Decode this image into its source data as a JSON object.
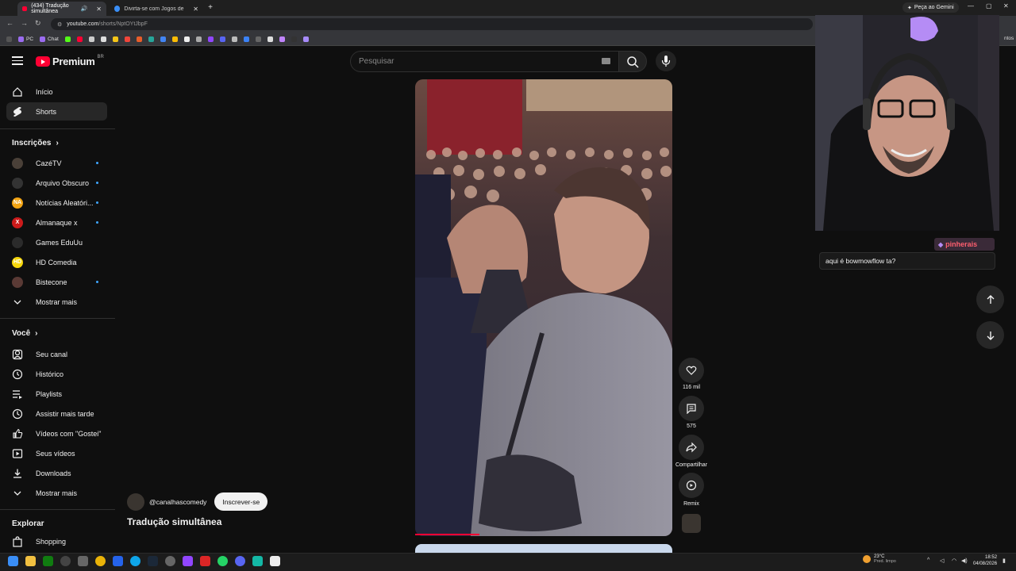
{
  "browser": {
    "tabs": [
      {
        "label": "(434) Tradução simultânea",
        "active": true
      },
      {
        "label": "Divirta-se com Jogos de Cassin",
        "active": false
      }
    ],
    "gemini_label": "Peça ao Gemini",
    "url_host": "youtube.com",
    "url_path": "/shorts/NptOYtJbpF",
    "bookmarks": [
      "PC",
      "Chat"
    ],
    "bookmark_tail": "ntos"
  },
  "header": {
    "logo_text": "Premium",
    "logo_region": "BR",
    "search_placeholder": "Pesquisar"
  },
  "sidebar": {
    "top_items": [
      {
        "label": "Início",
        "icon": "home-icon"
      },
      {
        "label": "Shorts",
        "icon": "shorts-icon",
        "active": true
      }
    ],
    "subscriptions_title": "Inscrições",
    "subscriptions": [
      {
        "label": "CazéTV",
        "new": true,
        "avatar_color": "#4a4038",
        "avatar_text": ""
      },
      {
        "label": "Arquivo Obscuro",
        "new": true,
        "avatar_color": "#333333",
        "avatar_text": ""
      },
      {
        "label": "Notícias Aleatóri...",
        "new": true,
        "avatar_color": "#f2a413",
        "avatar_text": "NA"
      },
      {
        "label": "Almanaque x",
        "new": true,
        "avatar_color": "#cc1b1b",
        "avatar_text": "X"
      },
      {
        "label": "Games EduUu",
        "new": false,
        "avatar_color": "#2b2b2b",
        "avatar_text": ""
      },
      {
        "label": "HD Comedia",
        "new": false,
        "avatar_color": "#f5d60b",
        "avatar_text": "HD"
      },
      {
        "label": "Bistecone",
        "new": true,
        "avatar_color": "#5a3a35",
        "avatar_text": ""
      }
    ],
    "subscriptions_more": "Mostrar mais",
    "you_title": "Você",
    "you_items": [
      {
        "label": "Seu canal",
        "icon": "channel-icon"
      },
      {
        "label": "Histórico",
        "icon": "history-icon"
      },
      {
        "label": "Playlists",
        "icon": "playlists-icon"
      },
      {
        "label": "Assistir mais tarde",
        "icon": "watch-later-icon"
      },
      {
        "label": "Vídeos com \"Gostei\"",
        "icon": "liked-icon"
      },
      {
        "label": "Seus vídeos",
        "icon": "your-videos-icon"
      },
      {
        "label": "Downloads",
        "icon": "downloads-icon"
      }
    ],
    "you_more": "Mostrar mais",
    "explore_title": "Explorar",
    "explore_items": [
      {
        "label": "Shopping",
        "icon": "shopping-icon"
      }
    ]
  },
  "short": {
    "channel": "@canalhascomedy",
    "subscribe_label": "Inscrever-se",
    "title": "Tradução simultânea",
    "progress": 0.25,
    "actions": {
      "likes": "116 mil",
      "comments": "575",
      "share": "Compartilhar",
      "remix": "Remix"
    }
  },
  "overlay": {
    "chat_user": "pinherais",
    "chat_message": "aqui é bowmowflow ta?"
  },
  "taskbar": {
    "temp": "23°C",
    "weather_desc": "Pred. limpo",
    "time": "18:52",
    "date": "04/08/2026"
  }
}
